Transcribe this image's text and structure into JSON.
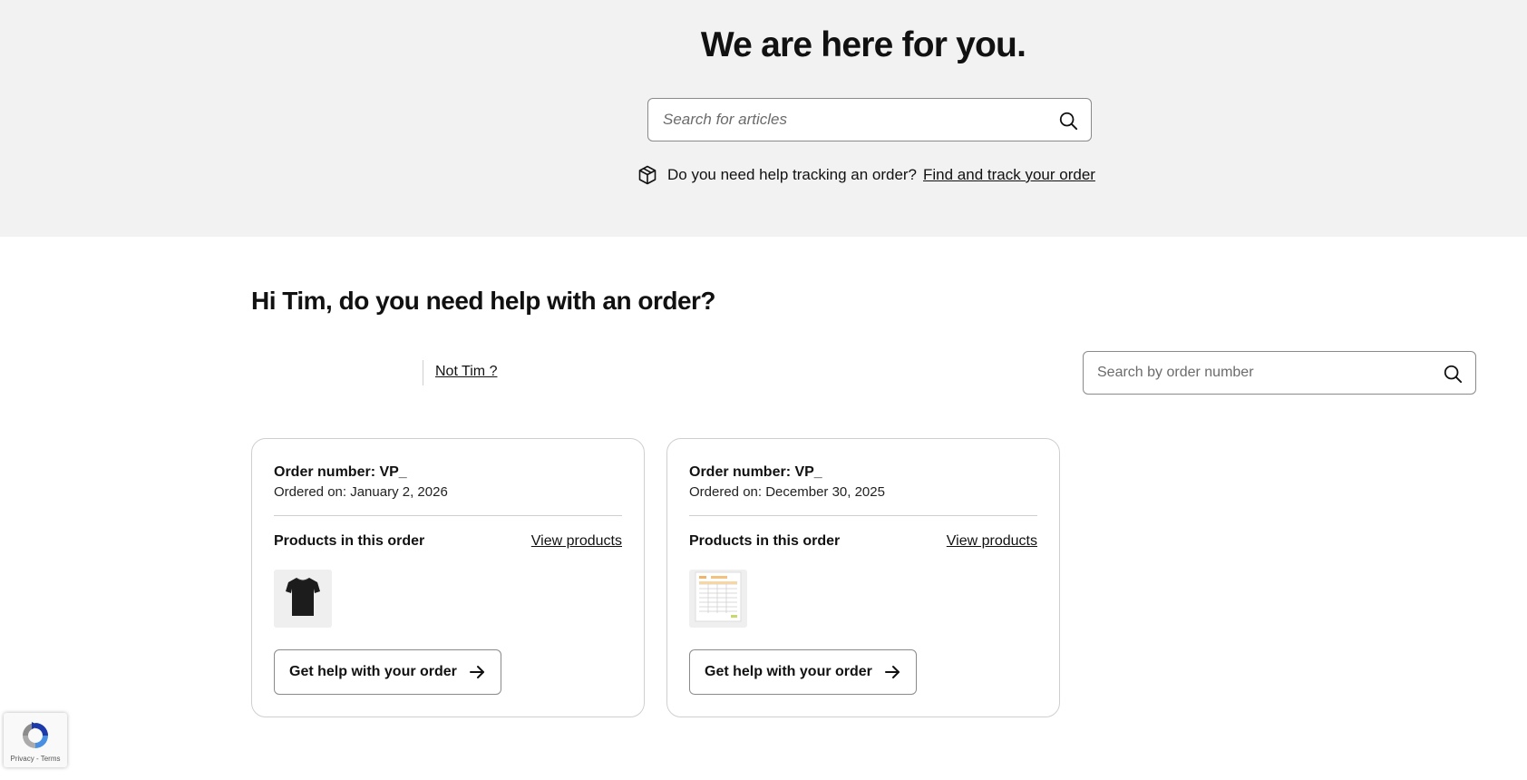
{
  "hero": {
    "title": "We are here for you.",
    "search_placeholder": "Search for articles",
    "tracking_text": "Do you need help tracking an order?",
    "tracking_link": "Find and track your order"
  },
  "orders_section": {
    "greeting": "Hi Tim, do you need help with an order?",
    "not_user_link": "Not Tim ?",
    "order_search_placeholder": "Search by order number"
  },
  "orders": [
    {
      "order_number": "Order number: VP_",
      "ordered_on": "Ordered on: January 2, 2026",
      "products_label": "Products in this order",
      "view_products": "View products",
      "thumbnail_icon": "black-tshirt-thumbnail",
      "help_button": "Get help with your order"
    },
    {
      "order_number": "Order number: VP_",
      "ordered_on": "Ordered on: December 30, 2025",
      "products_label": "Products in this order",
      "view_products": "View products",
      "thumbnail_icon": "document-table-thumbnail",
      "help_button": "Get help with your order"
    }
  ],
  "recaptcha": {
    "privacy": "Privacy",
    "separator": " - ",
    "terms": "Terms"
  },
  "colors": {
    "hero_background": "#f2f2f2",
    "border": "#8a8a8a",
    "text": "#111111"
  }
}
